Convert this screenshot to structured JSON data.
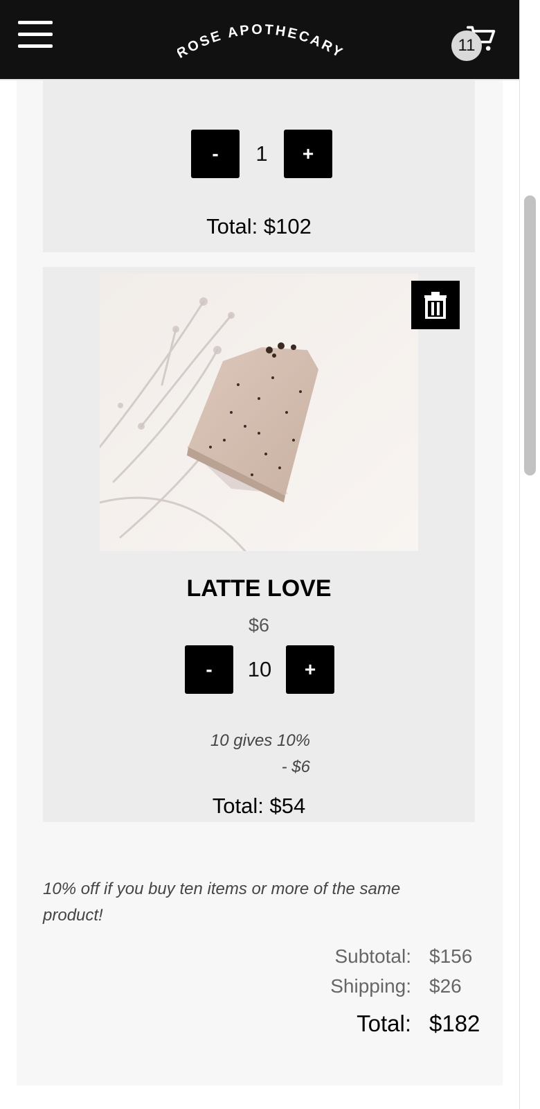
{
  "header": {
    "brand": "ROSE APOTHECARY",
    "cart_count": "11"
  },
  "cart_items": [
    {
      "quantity": "1",
      "decrement_label": "-",
      "increment_label": "+",
      "total": "Total: $102"
    },
    {
      "name": "LATTE LOVE",
      "price": "$6",
      "quantity": "10",
      "decrement_label": "-",
      "increment_label": "+",
      "discount_text": "10 gives 10%",
      "discount_amount": "- $6",
      "total": "Total: $54"
    }
  ],
  "promo_note": "10% off if you buy ten items or more of the same product!",
  "summary": {
    "subtotal_label": "Subtotal:",
    "subtotal_value": "$156",
    "shipping_label": "Shipping:",
    "shipping_value": "$26",
    "total_label": "Total:",
    "total_value": "$182"
  },
  "icons": {
    "menu": "hamburger-menu-icon",
    "cart": "shopping-cart-icon",
    "delete": "trash-icon"
  },
  "colors": {
    "header_bg": "#111111",
    "button_bg": "#000000",
    "card_bg": "#ececec",
    "panel_bg": "#f7f7f7"
  }
}
